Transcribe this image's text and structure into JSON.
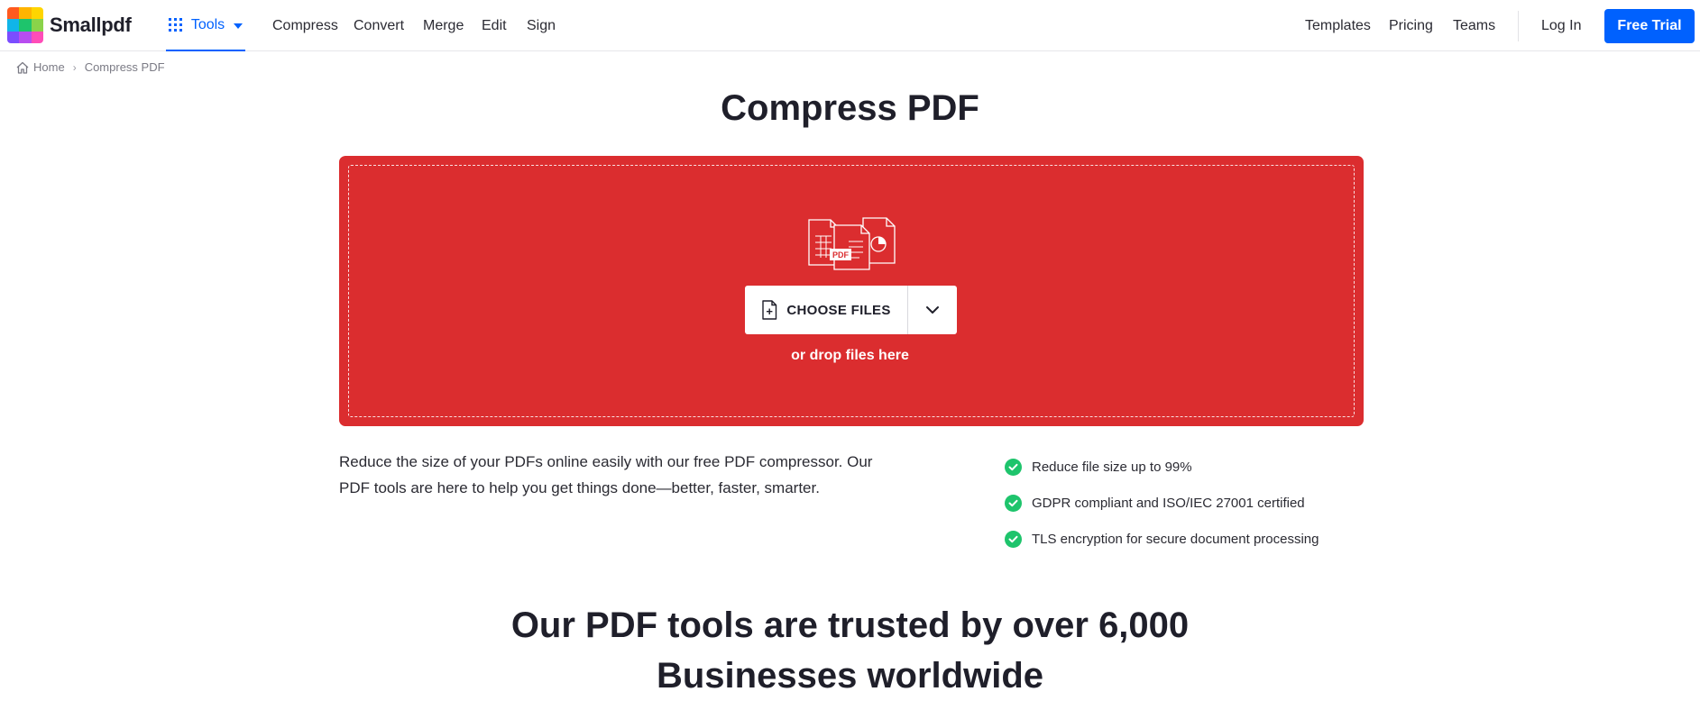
{
  "brand": {
    "name": "Smallpdf"
  },
  "nav": {
    "tools_label": "Tools",
    "links": [
      "Compress",
      "Convert",
      "Merge",
      "Edit",
      "Sign"
    ],
    "right_links": [
      "Templates",
      "Pricing",
      "Teams"
    ],
    "login_label": "Log In",
    "free_trial_label": "Free Trial"
  },
  "breadcrumb": {
    "home": "Home",
    "current": "Compress PDF"
  },
  "page_title": "Compress PDF",
  "dropzone": {
    "choose_files_label": "CHOOSE FILES",
    "drop_hint": "or drop files here",
    "illustration_badge": "PDF",
    "background_color": "#db2d2f"
  },
  "description": "Reduce the size of your PDFs online easily with our free PDF compressor. Our PDF tools are here to help you get things done—better, faster, smarter.",
  "features": [
    "Reduce file size up to 99%",
    "GDPR compliant and ISO/IEC 27001 certified",
    "TLS encryption for secure document processing"
  ],
  "trusted": {
    "line1": "Our PDF tools are trusted by over 6,000",
    "line2": "Businesses worldwide"
  },
  "colors": {
    "accent": "#0061fe",
    "check": "#1ec46c"
  },
  "icons": [
    "grid-icon",
    "caret-down-icon",
    "home-icon",
    "file-plus-icon",
    "chevron-down-icon",
    "check-icon",
    "documents-icon"
  ]
}
